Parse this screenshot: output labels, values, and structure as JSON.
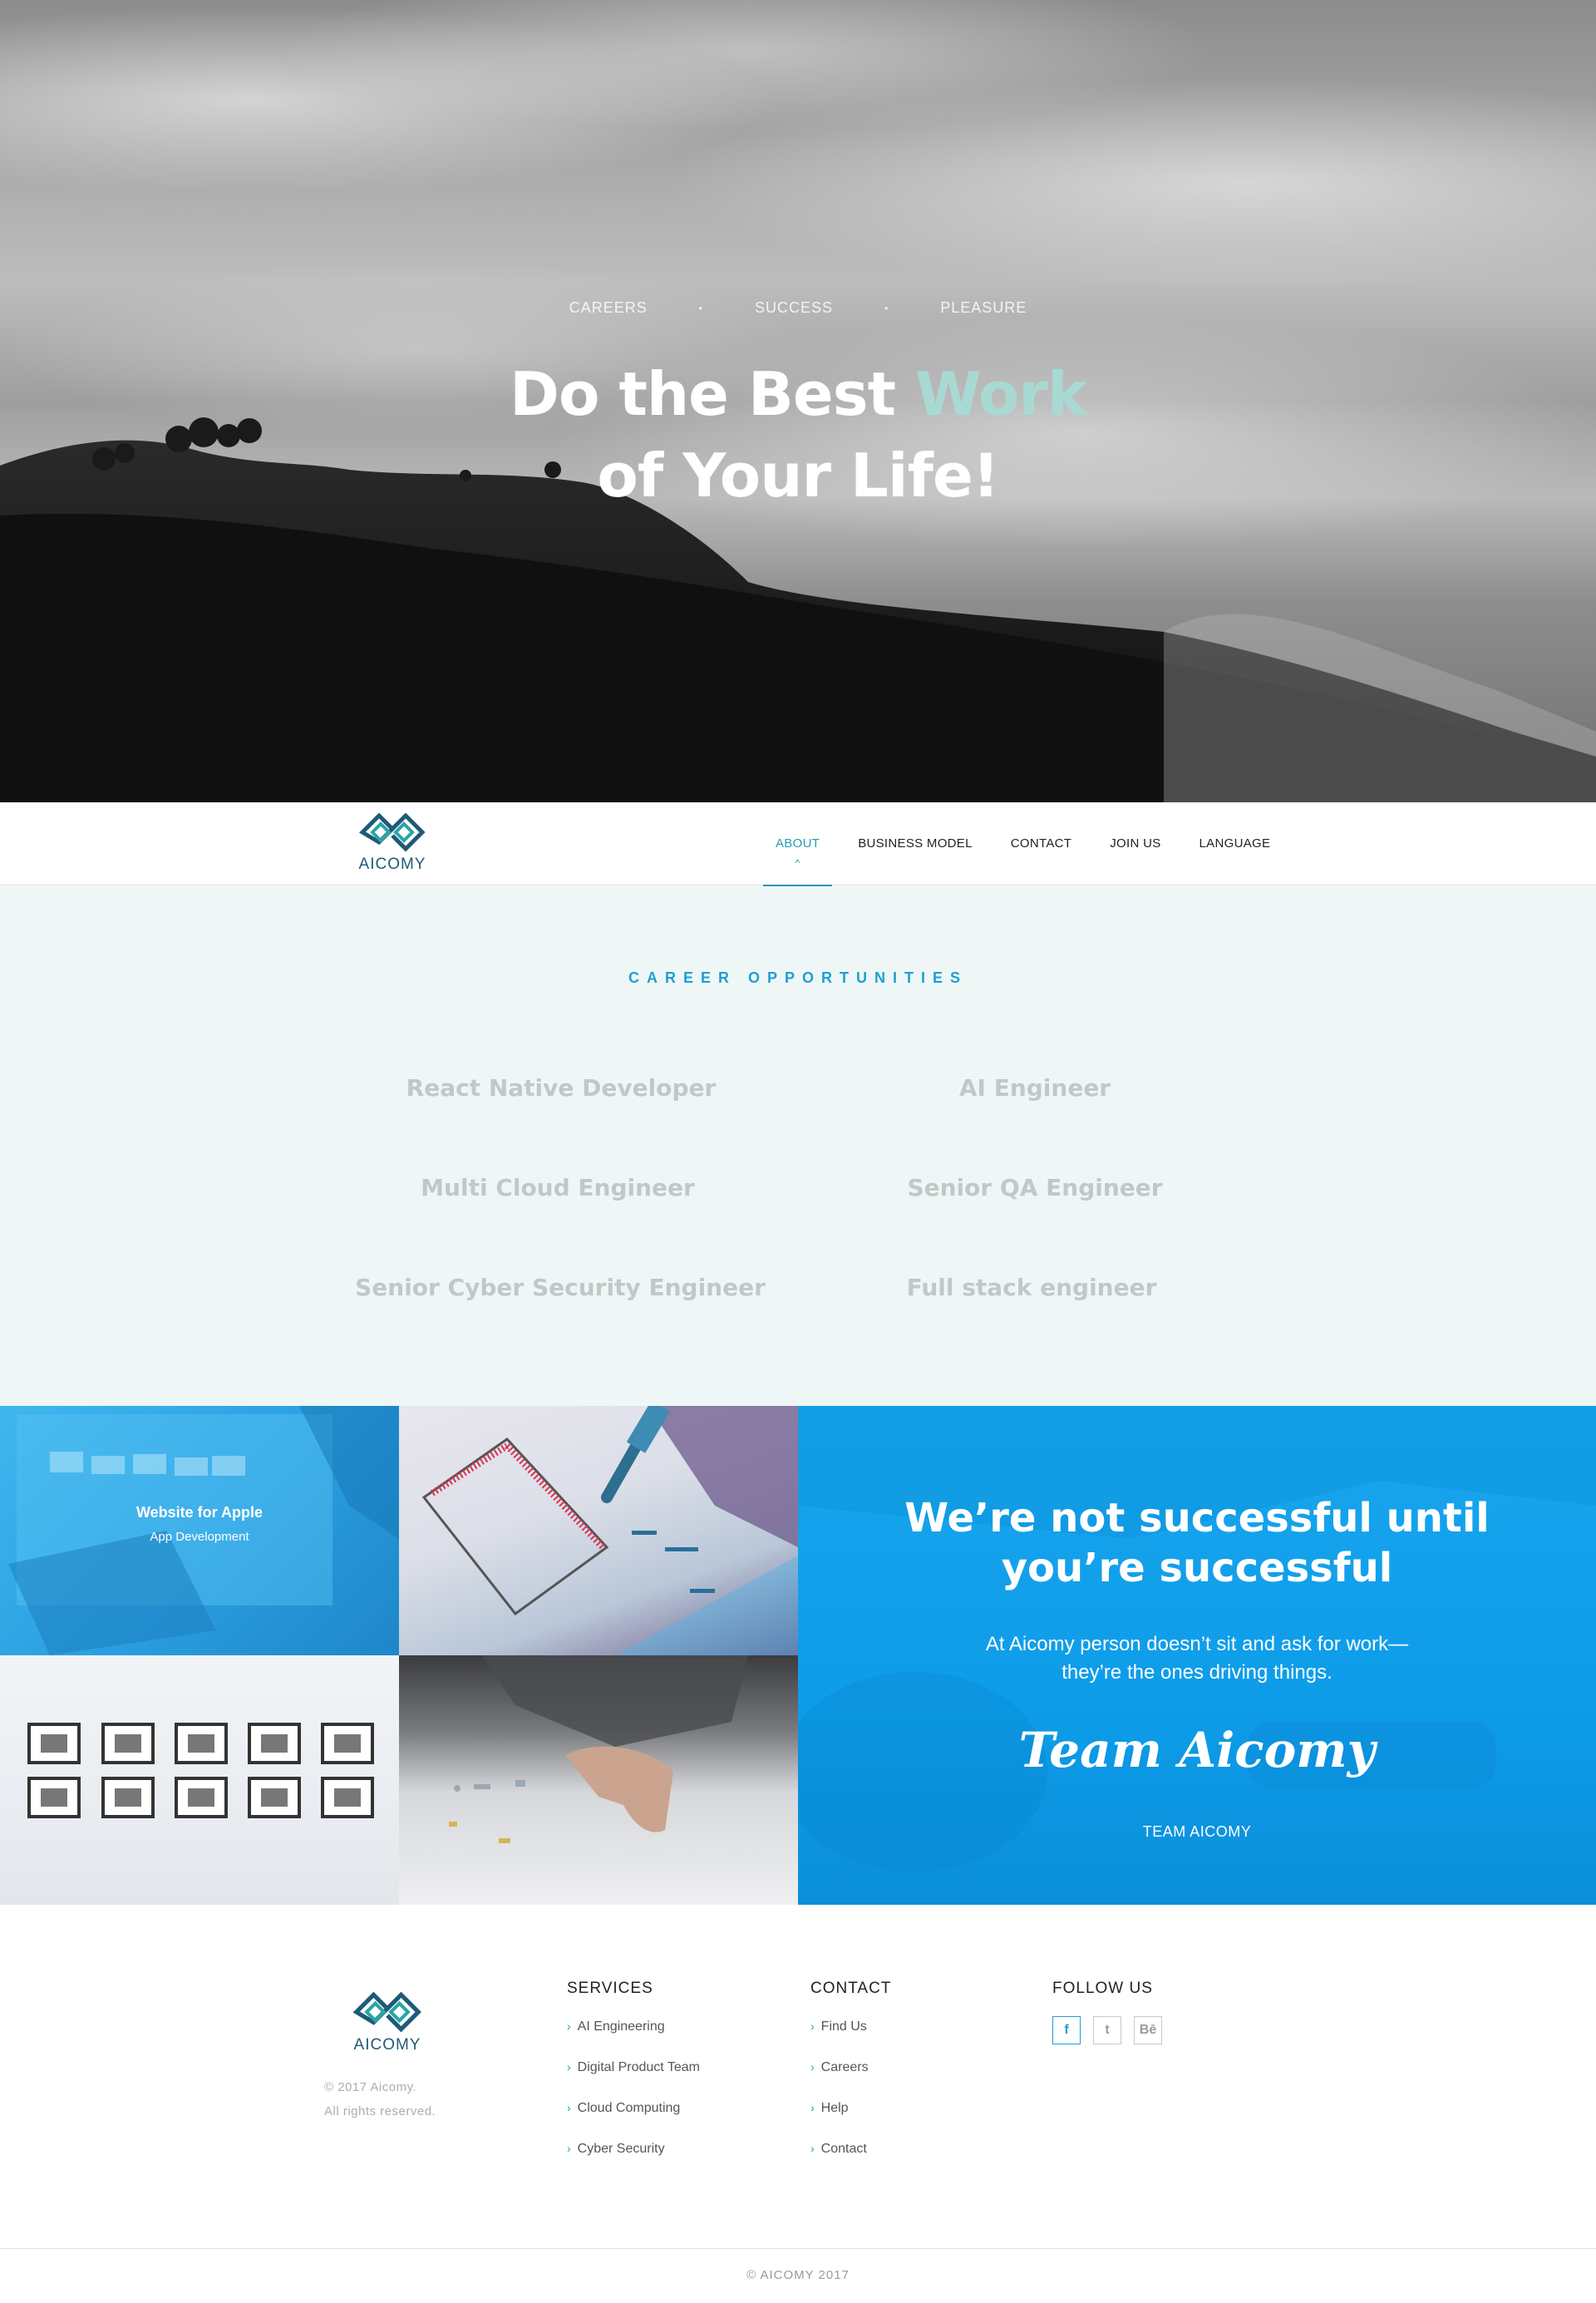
{
  "hero": {
    "tags": [
      "CAREERS",
      "SUCCESS",
      "PLEASURE"
    ],
    "separator": "•",
    "title_line1_pre": "Do the Best ",
    "title_line1_accent": "Work",
    "title_line2": "of Your Life!"
  },
  "nav": {
    "logo_text": "AICOMY",
    "items": [
      "ABOUT",
      "BUSINESS MODEL",
      "CONTACT",
      "JOIN US",
      "LANGUAGE"
    ],
    "active_item": "ABOUT",
    "active_marker": "^"
  },
  "careers": {
    "title": "CAREER OPPORTUNITIES",
    "jobs": [
      "React Native Developer",
      "AI Engineer",
      "Multi Cloud Engineer",
      "Senior QA Engineer",
      "Senior Cyber Security Engineer",
      "Full stack engineer"
    ]
  },
  "portfolio": {
    "tile1_title": "Website for Apple",
    "tile1_subtitle": "App Development"
  },
  "quote": {
    "title_line1": "We’re not successful until",
    "title_line2": "you’re successful",
    "text_line1": "At Aicomy person doesn’t sit and ask for work—",
    "text_line2": "they’re the ones driving things.",
    "signature": "Team Aicomy",
    "label": "TEAM AICOMY"
  },
  "footer": {
    "logo_text": "AICOMY",
    "copyright_line1": "© 2017 Aicomy.",
    "copyright_line2": "All rights reserved.",
    "services_title": "SERVICES",
    "services": [
      "AI Engineering",
      "Digital Product Team",
      "Cloud Computing",
      "Cyber Security"
    ],
    "contact_title": "CONTACT",
    "contact": [
      "Find Us",
      "Careers",
      "Help",
      "Contact"
    ],
    "follow_title": "FOLLOW US",
    "social": [
      "f",
      "t",
      "Bē"
    ],
    "bottom": "© AICOMY 2017"
  },
  "colors": {
    "accent": "#2a9ab0",
    "brand_blue": "#1f9fd2",
    "quote_bg": "#0d9ce9",
    "careers_bg": "#eef7f6",
    "hero_accent_text": "#a9d9d3"
  },
  "icons": [
    "aicomy-logo-icon",
    "chevron-right-icon",
    "facebook-icon",
    "twitter-icon",
    "behance-icon"
  ]
}
